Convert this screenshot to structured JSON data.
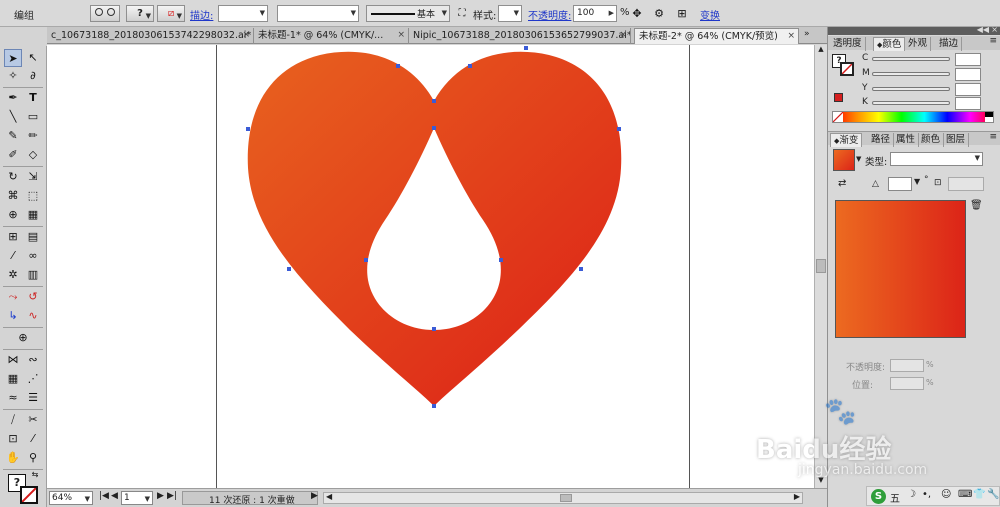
{
  "controlbar": {
    "mode_label": "编组",
    "stroke_label": "描边:",
    "profile_label": "基本",
    "style_label": "样式:",
    "opacity_label": "不透明度:",
    "opacity_value": "100",
    "opacity_unit": "%",
    "transform_label": "变换"
  },
  "tabs": [
    {
      "label": "c_10673188_20180306153742298032.ai*"
    },
    {
      "label": "未标题-1* @ 64% (CMYK/..."
    },
    {
      "label": "Nipic_10673188_20180306153652799037.ai*"
    },
    {
      "label": "未标题-2* @ 64% (CMYK/预览)"
    }
  ],
  "status": {
    "zoom": "64%",
    "page": "1",
    "history": "11 次还原 : 1 次重做"
  },
  "color_panel": {
    "tabs": [
      "透明度",
      "颜色",
      "外观",
      "描边"
    ],
    "active_tab": "颜色",
    "channels": [
      "C",
      "M",
      "Y",
      "K"
    ]
  },
  "gradient_panel": {
    "tabs": [
      "渐变",
      "路径",
      "属性",
      "颜色",
      "图层"
    ],
    "active_tab": "渐变",
    "type_label": "类型:",
    "angle_symbol": "°",
    "opacity_label": "不透明度:",
    "position_label": "位置:",
    "percent": "%",
    "gradient_start": "#ec6a20",
    "gradient_end": "#dc2418"
  },
  "watermark": {
    "brand": "Baidu经验",
    "url": "jingyan.baidu.com"
  },
  "tray": {
    "ime_label": "五"
  },
  "artwork": {
    "color_start": "#e8621f",
    "color_end": "#dc1f17"
  }
}
